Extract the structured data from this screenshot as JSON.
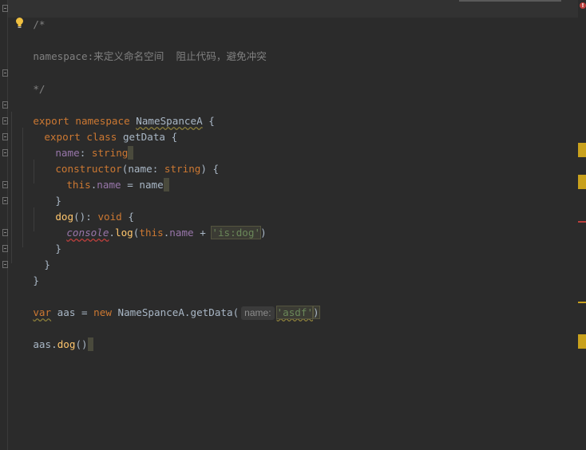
{
  "editor": {
    "comment_open": "/*",
    "comment_text": "namespace:来定义命名空间  阻止代码，避免冲突",
    "comment_close": "*/",
    "line_export_kw": "export namespace",
    "line_namespace_name": "NameSpanceA",
    "line_open_brace": " {",
    "class_kw": "export class",
    "class_name": "getData",
    "class_brace": " {",
    "prop_name": "name",
    "prop_colon": ": ",
    "prop_type": "string",
    "ctor_kw": "constructor",
    "ctor_open": "(",
    "ctor_param": "name",
    "ctor_colon": ": ",
    "ctor_type": "string",
    "ctor_close": ") {",
    "assign_this": "this",
    "assign_dot": ".",
    "assign_prop": "name",
    "assign_eq": " = ",
    "assign_val": "name",
    "close_brace_1": "}",
    "method_name": "dog",
    "method_sig": "(): ",
    "method_type": "void",
    "method_brace": " {",
    "console_obj": "console",
    "console_dot": ".",
    "console_log": "log",
    "console_open": "(",
    "console_this": "this",
    "console_dot2": ".",
    "console_prop": "name",
    "console_plus": " + ",
    "console_str": "'is:dog'",
    "console_close": ")",
    "close_brace_2": "}",
    "close_brace_3": "}",
    "close_brace_4": "}",
    "var_kw": "var",
    "var_name": " aas = ",
    "new_kw": "new",
    "new_target": " NameSpanceA.",
    "new_fn": "getData",
    "new_open": "(",
    "hint_label": "name:",
    "new_arg": "'asdf'",
    "new_close": ")",
    "call_obj": "aas.",
    "call_fn": "dog",
    "call_parens": "()"
  },
  "gutter": {
    "error_badge": "!"
  },
  "colors": {
    "background": "#2b2b2b",
    "keyword": "#cc7832",
    "function": "#ffc66d",
    "property": "#9876aa",
    "string": "#6a8759",
    "comment": "#808080",
    "text": "#a9b7c6",
    "warning_marker": "#c9a11c",
    "error_marker": "#bc3f3c"
  }
}
